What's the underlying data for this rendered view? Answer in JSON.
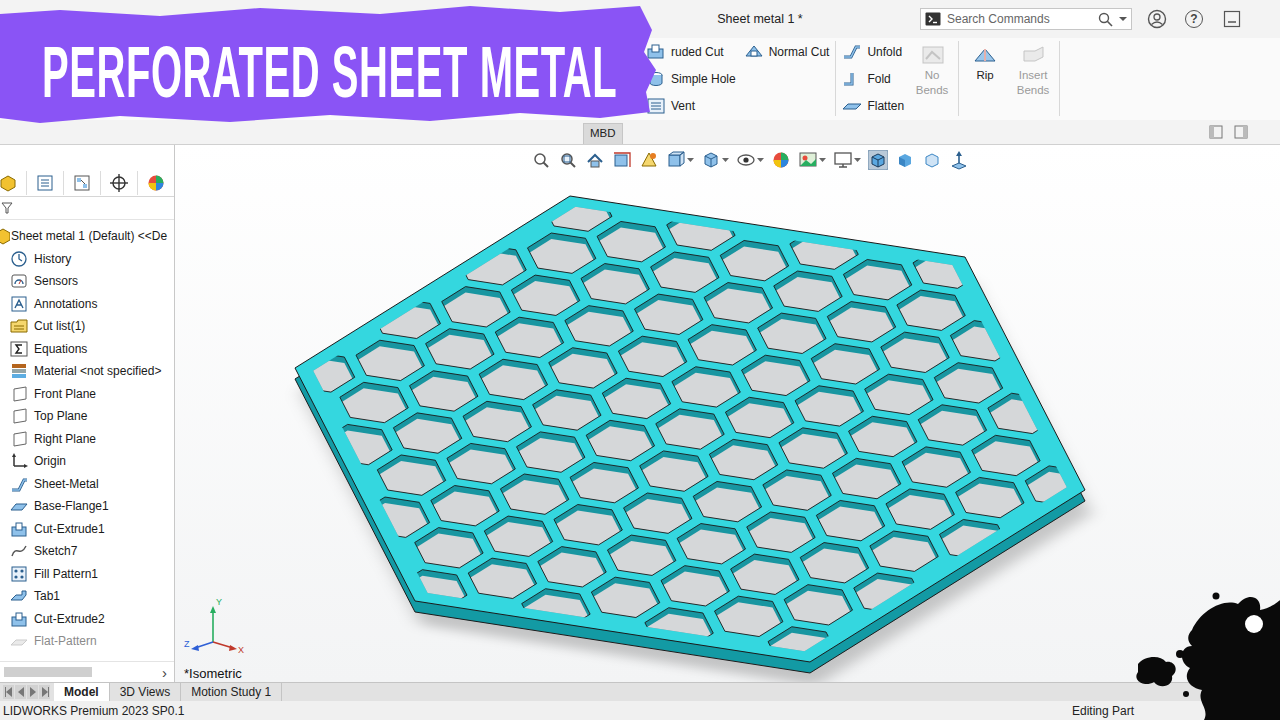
{
  "banner": {
    "text": "PERFORATED SHEET METAL"
  },
  "window": {
    "title": "Sheet metal 1 *",
    "help_glyph": "?"
  },
  "search": {
    "placeholder": "Search Commands"
  },
  "ribbon": {
    "groups": [
      {
        "columns": [
          [
            {
              "label": "ruded Cut",
              "disabled": false,
              "kind": "small"
            },
            {
              "label": "Simple Hole",
              "disabled": false,
              "kind": "small"
            },
            {
              "label": "Vent",
              "disabled": false,
              "kind": "small"
            }
          ],
          [
            {
              "label": "Normal Cut",
              "disabled": false,
              "kind": "small"
            }
          ]
        ]
      },
      {
        "columns": [
          [
            {
              "label": "Unfold",
              "disabled": false,
              "kind": "small"
            },
            {
              "label": "Fold",
              "disabled": false,
              "kind": "small"
            },
            {
              "label": "Flatten",
              "disabled": false,
              "kind": "small"
            }
          ],
          [
            {
              "label": "No Bends",
              "disabled": true,
              "kind": "large"
            }
          ]
        ]
      },
      {
        "columns": [
          [
            {
              "label": "Rip",
              "disabled": false,
              "kind": "large"
            }
          ],
          [
            {
              "label": "Insert Bends",
              "disabled": true,
              "kind": "large"
            }
          ]
        ]
      }
    ]
  },
  "command_tabs": [
    {
      "label": "MBD",
      "selected": false
    }
  ],
  "feature_tree": {
    "items": [
      {
        "label": "Sheet metal 1 (Default) <<De",
        "greyed": false,
        "kind": "root"
      },
      {
        "label": "History",
        "greyed": false,
        "kind": "item"
      },
      {
        "label": "Sensors",
        "greyed": false,
        "kind": "item"
      },
      {
        "label": "Annotations",
        "greyed": false,
        "kind": "item"
      },
      {
        "label": "Cut list(1)",
        "greyed": false,
        "kind": "item"
      },
      {
        "label": "Equations",
        "greyed": false,
        "kind": "item"
      },
      {
        "label": "Material <not specified>",
        "greyed": false,
        "kind": "item"
      },
      {
        "label": "Front Plane",
        "greyed": false,
        "kind": "item"
      },
      {
        "label": "Top Plane",
        "greyed": false,
        "kind": "item"
      },
      {
        "label": "Right Plane",
        "greyed": false,
        "kind": "item"
      },
      {
        "label": "Origin",
        "greyed": false,
        "kind": "item"
      },
      {
        "label": "Sheet-Metal",
        "greyed": false,
        "kind": "item"
      },
      {
        "label": "Base-Flange1",
        "greyed": false,
        "kind": "item"
      },
      {
        "label": "Cut-Extrude1",
        "greyed": false,
        "kind": "item"
      },
      {
        "label": "Sketch7",
        "greyed": false,
        "kind": "item"
      },
      {
        "label": "Fill Pattern1",
        "greyed": false,
        "kind": "item"
      },
      {
        "label": "Tab1",
        "greyed": false,
        "kind": "item"
      },
      {
        "label": "Cut-Extrude2",
        "greyed": false,
        "kind": "item"
      },
      {
        "label": "Flat-Pattern",
        "greyed": true,
        "kind": "item"
      }
    ],
    "scroll_arrow": "›"
  },
  "viewport": {
    "view_label": "*Isometric",
    "triad_labels": {
      "y": "Y",
      "z": "Z",
      "x": "X"
    }
  },
  "bottom_tabs": [
    {
      "label": "Model",
      "selected": true
    },
    {
      "label": "3D Views",
      "selected": false
    },
    {
      "label": "Motion Study 1",
      "selected": false
    }
  ],
  "status_bar": {
    "app": "LIDWORKS Premium 2023 SP0.1",
    "mode": "Editing Part"
  }
}
